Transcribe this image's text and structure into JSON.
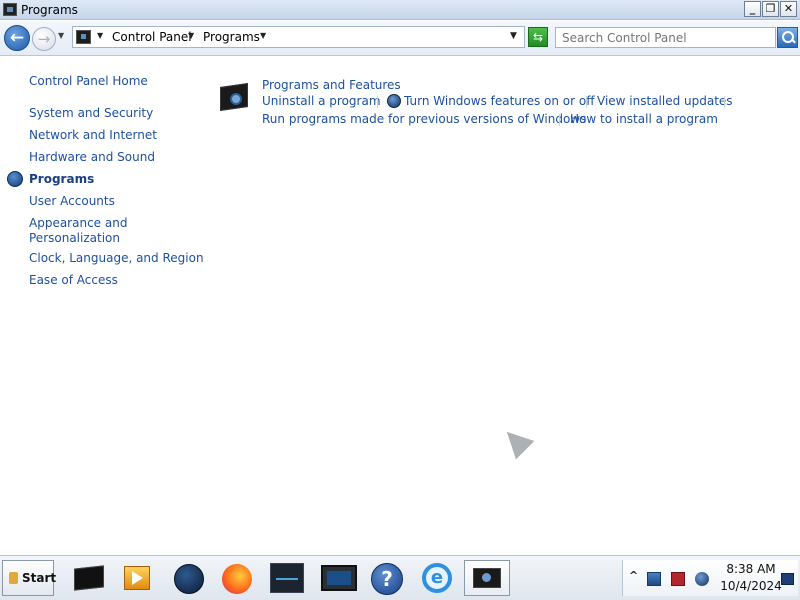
{
  "window": {
    "title": "Programs",
    "buttons": {
      "minimize": "_",
      "restore": "❐",
      "close": "✕"
    }
  },
  "address_bar": {
    "back_glyph": "←",
    "forward_glyph": "→",
    "breadcrumbs": [
      "Control Panel",
      "Programs"
    ],
    "search_placeholder": "Search Control Panel"
  },
  "sidebar": {
    "home": "Control Panel Home",
    "items": [
      {
        "label": "System and Security"
      },
      {
        "label": "Network and Internet"
      },
      {
        "label": "Hardware and Sound"
      },
      {
        "label": "Programs",
        "active": true
      },
      {
        "label": "User Accounts"
      },
      {
        "label": "Appearance and",
        "label2": "Personalization"
      },
      {
        "label": "Clock, Language, and Region"
      },
      {
        "label": "Ease of Access"
      }
    ]
  },
  "main": {
    "section_title": "Programs and Features",
    "links": {
      "uninstall": "Uninstall a program",
      "windows_features": "Turn Windows features on or off",
      "installed_updates": "View installed updates",
      "compat": "Run programs made for previous versions of Windows",
      "how_to_install": "How to install a program"
    }
  },
  "taskbar": {
    "start_label": "Start",
    "items": [
      "terminal-icon",
      "media-player-icon",
      "globe-app-icon",
      "firefox-icon",
      "monitor-app-icon",
      "display-app-icon",
      "help-icon",
      "internet-explorer-icon",
      "control-panel-icon"
    ],
    "clock": {
      "time": "8:38 AM",
      "date": "10/4/2024"
    },
    "tray_chevron": "^"
  }
}
